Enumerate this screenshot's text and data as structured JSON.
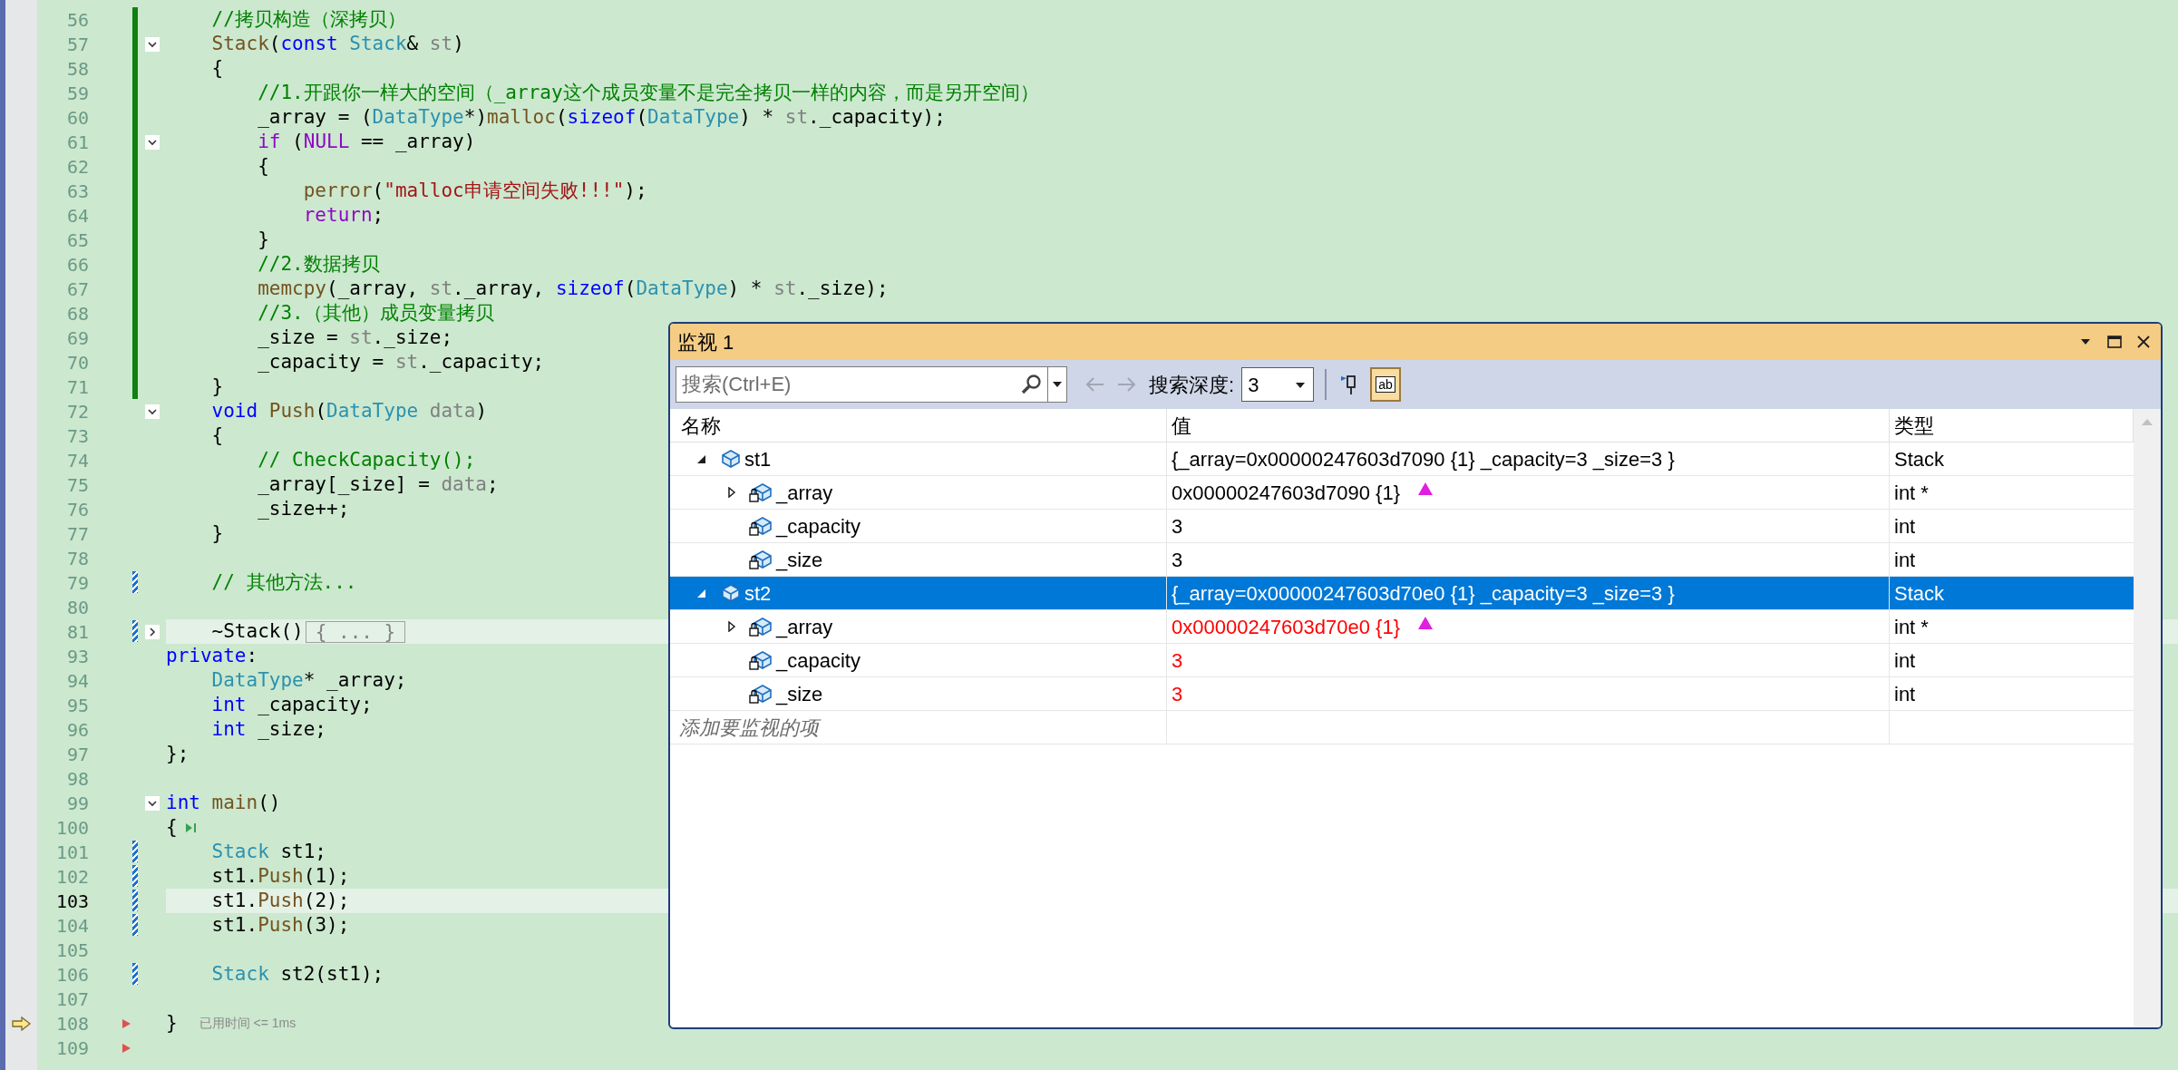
{
  "editor": {
    "lines": [
      {
        "number": "56",
        "saved_change": true,
        "tokens": [
          {
            "text": "    //拷贝构造（深拷贝）",
            "kind": "comment"
          }
        ]
      },
      {
        "number": "57",
        "saved_change": true,
        "foldable": true,
        "collapsed": false,
        "tokens": [
          {
            "text": "    Stack",
            "kind": "function"
          },
          {
            "text": "(",
            "kind": "plain"
          },
          {
            "text": "const",
            "kind": "keyword"
          },
          {
            "text": " Stack",
            "kind": "type"
          },
          {
            "text": "& ",
            "kind": "plain"
          },
          {
            "text": "st",
            "kind": "param"
          },
          {
            "text": ")",
            "kind": "plain"
          }
        ]
      },
      {
        "number": "58",
        "saved_change": true,
        "tokens": [
          {
            "text": "    {",
            "kind": "plain"
          }
        ]
      },
      {
        "number": "59",
        "saved_change": true,
        "tokens": [
          {
            "text": "        //1.开跟你一样大的空间（_array这个成员变量不是完全拷贝一样的内容，而是另开空间）",
            "kind": "comment"
          }
        ]
      },
      {
        "number": "60",
        "saved_change": true,
        "tokens": [
          {
            "text": "        _array = (",
            "kind": "plain"
          },
          {
            "text": "DataType",
            "kind": "type"
          },
          {
            "text": "*)",
            "kind": "plain"
          },
          {
            "text": "malloc",
            "kind": "function"
          },
          {
            "text": "(",
            "kind": "plain"
          },
          {
            "text": "sizeof",
            "kind": "keyword"
          },
          {
            "text": "(",
            "kind": "plain"
          },
          {
            "text": "DataType",
            "kind": "type"
          },
          {
            "text": ") * ",
            "kind": "plain"
          },
          {
            "text": "st",
            "kind": "param"
          },
          {
            "text": "._capacity);",
            "kind": "plain"
          }
        ]
      },
      {
        "number": "61",
        "saved_change": true,
        "foldable": true,
        "collapsed": false,
        "tokens": [
          {
            "text": "        if",
            "kind": "control"
          },
          {
            "text": " (",
            "kind": "plain"
          },
          {
            "text": "NULL",
            "kind": "control"
          },
          {
            "text": " == _array)",
            "kind": "plain"
          }
        ]
      },
      {
        "number": "62",
        "saved_change": true,
        "tokens": [
          {
            "text": "        {",
            "kind": "plain"
          }
        ]
      },
      {
        "number": "63",
        "saved_change": true,
        "tokens": [
          {
            "text": "            perror",
            "kind": "function"
          },
          {
            "text": "(",
            "kind": "plain"
          },
          {
            "text": "\"malloc申请空间失败!!!\"",
            "kind": "string"
          },
          {
            "text": ");",
            "kind": "plain"
          }
        ]
      },
      {
        "number": "64",
        "saved_change": true,
        "tokens": [
          {
            "text": "            return",
            "kind": "control"
          },
          {
            "text": ";",
            "kind": "plain"
          }
        ]
      },
      {
        "number": "65",
        "saved_change": true,
        "tokens": [
          {
            "text": "        }",
            "kind": "plain"
          }
        ]
      },
      {
        "number": "66",
        "saved_change": true,
        "tokens": [
          {
            "text": "        //2.数据拷贝",
            "kind": "comment"
          }
        ]
      },
      {
        "number": "67",
        "saved_change": true,
        "tokens": [
          {
            "text": "        memcpy",
            "kind": "function"
          },
          {
            "text": "(_array, ",
            "kind": "plain"
          },
          {
            "text": "st",
            "kind": "param"
          },
          {
            "text": "._array, ",
            "kind": "plain"
          },
          {
            "text": "sizeof",
            "kind": "keyword"
          },
          {
            "text": "(",
            "kind": "plain"
          },
          {
            "text": "DataType",
            "kind": "type"
          },
          {
            "text": ") * ",
            "kind": "plain"
          },
          {
            "text": "st",
            "kind": "param"
          },
          {
            "text": "._size);",
            "kind": "plain"
          }
        ]
      },
      {
        "number": "68",
        "saved_change": true,
        "tokens": [
          {
            "text": "        //3.（其他）成员变量拷贝",
            "kind": "comment"
          }
        ]
      },
      {
        "number": "69",
        "saved_change": true,
        "tokens": [
          {
            "text": "        _size = ",
            "kind": "plain"
          },
          {
            "text": "st",
            "kind": "param"
          },
          {
            "text": "._size;",
            "kind": "plain"
          }
        ]
      },
      {
        "number": "70",
        "saved_change": true,
        "tokens": [
          {
            "text": "        _capacity = ",
            "kind": "plain"
          },
          {
            "text": "st",
            "kind": "param"
          },
          {
            "text": "._capacity;",
            "kind": "plain"
          }
        ]
      },
      {
        "number": "71",
        "saved_change": true,
        "tokens": [
          {
            "text": "    }",
            "kind": "plain"
          }
        ]
      },
      {
        "number": "72",
        "foldable": true,
        "collapsed": false,
        "tokens": [
          {
            "text": "    void",
            "kind": "keyword"
          },
          {
            "text": " Push",
            "kind": "function"
          },
          {
            "text": "(",
            "kind": "plain"
          },
          {
            "text": "DataType",
            "kind": "type"
          },
          {
            "text": " data",
            "kind": "param"
          },
          {
            "text": ")",
            "kind": "plain"
          }
        ]
      },
      {
        "number": "73",
        "tokens": [
          {
            "text": "    {",
            "kind": "plain"
          }
        ]
      },
      {
        "number": "74",
        "tokens": [
          {
            "text": "        // CheckCapacity();",
            "kind": "comment"
          }
        ]
      },
      {
        "number": "75",
        "tokens": [
          {
            "text": "        _array[_size] = ",
            "kind": "plain"
          },
          {
            "text": "data",
            "kind": "param"
          },
          {
            "text": ";",
            "kind": "plain"
          }
        ]
      },
      {
        "number": "76",
        "tokens": [
          {
            "text": "        _size++;",
            "kind": "plain"
          }
        ]
      },
      {
        "number": "77",
        "tokens": [
          {
            "text": "    }",
            "kind": "plain"
          }
        ]
      },
      {
        "number": "78"
      },
      {
        "number": "79",
        "unsaved_change": true,
        "tokens": [
          {
            "text": "    // 其他方法...",
            "kind": "comment"
          }
        ]
      },
      {
        "number": "80"
      },
      {
        "number": "81",
        "unsaved_change": true,
        "foldable": true,
        "collapsed": true,
        "highlight": true,
        "tokens": [
          {
            "text": "    ~Stack()",
            "kind": "plain"
          },
          {
            "text": "{ ... }",
            "kind": "collapsed"
          }
        ]
      },
      {
        "number": "93",
        "tokens": [
          {
            "text": "private",
            "kind": "keyword"
          },
          {
            "text": ":",
            "kind": "plain"
          }
        ]
      },
      {
        "number": "94",
        "tokens": [
          {
            "text": "    DataType",
            "kind": "type"
          },
          {
            "text": "* _array;",
            "kind": "plain"
          }
        ]
      },
      {
        "number": "95",
        "tokens": [
          {
            "text": "    int",
            "kind": "keyword"
          },
          {
            "text": " _capacity;",
            "kind": "plain"
          }
        ]
      },
      {
        "number": "96",
        "tokens": [
          {
            "text": "    int",
            "kind": "keyword"
          },
          {
            "text": " _size;",
            "kind": "plain"
          }
        ]
      },
      {
        "number": "97",
        "tokens": [
          {
            "text": "};",
            "kind": "plain"
          }
        ]
      },
      {
        "number": "98"
      },
      {
        "number": "99",
        "foldable": true,
        "collapsed": false,
        "tokens": [
          {
            "text": "int",
            "kind": "keyword"
          },
          {
            "text": " main",
            "kind": "function"
          },
          {
            "text": "()",
            "kind": "plain"
          }
        ]
      },
      {
        "number": "100",
        "run_to_click": true,
        "tokens": [
          {
            "text": "{",
            "kind": "plain"
          }
        ]
      },
      {
        "number": "101",
        "unsaved_change": true,
        "tokens": [
          {
            "text": "    Stack",
            "kind": "type"
          },
          {
            "text": " st1;",
            "kind": "plain"
          }
        ]
      },
      {
        "number": "102",
        "unsaved_change": true,
        "tokens": [
          {
            "text": "    st1.",
            "kind": "plain"
          },
          {
            "text": "Push",
            "kind": "function"
          },
          {
            "text": "(1);",
            "kind": "plain"
          }
        ]
      },
      {
        "number": "103",
        "unsaved_change": true,
        "highlight": true,
        "current": true,
        "tokens": [
          {
            "text": "    st1.",
            "kind": "plain"
          },
          {
            "text": "Push",
            "kind": "function"
          },
          {
            "text": "(2);",
            "kind": "plain"
          }
        ]
      },
      {
        "number": "104",
        "unsaved_change": true,
        "tokens": [
          {
            "text": "    st1.",
            "kind": "plain"
          },
          {
            "text": "Push",
            "kind": "function"
          },
          {
            "text": "(3);",
            "kind": "plain"
          }
        ]
      },
      {
        "number": "105"
      },
      {
        "number": "106",
        "unsaved_change": true,
        "tokens": [
          {
            "text": "    Stack",
            "kind": "type"
          },
          {
            "text": " st2(st1);",
            "kind": "plain"
          }
        ]
      },
      {
        "number": "107"
      },
      {
        "number": "108",
        "execution": true,
        "marker": true,
        "hint": "已用时间 <= 1ms",
        "tokens": [
          {
            "text": "}",
            "kind": "plain"
          }
        ]
      },
      {
        "number": "109",
        "marker": true
      }
    ]
  },
  "watch": {
    "title": "监视 1",
    "search": {
      "placeholder": "搜索(Ctrl+E)"
    },
    "depth_label": "搜索深度:",
    "depth": "3",
    "hex_toggle": {
      "label": "ab",
      "on": true
    },
    "columns": [
      "名称",
      "值",
      "类型"
    ],
    "rows": [
      {
        "name": "st1",
        "kind": "object",
        "value": "{_array=0x00000247603d7090 {1} _capacity=3 _size=3 }",
        "type": "Stack",
        "expanded": true,
        "selected": false,
        "changed": false,
        "children": [
          {
            "name": "_array",
            "kind": "member",
            "value": "0x00000247603d7090 {1}",
            "type": "int *",
            "expanded": false,
            "selected": false,
            "changed": false,
            "pointer_marker": true
          },
          {
            "name": "_capacity",
            "kind": "member",
            "value": "3",
            "type": "int",
            "selected": false,
            "changed": false
          },
          {
            "name": "_size",
            "kind": "member",
            "value": "3",
            "type": "int",
            "selected": false,
            "changed": false
          }
        ]
      },
      {
        "name": "st2",
        "kind": "object",
        "value": "{_array=0x00000247603d70e0 {1} _capacity=3 _size=3 }",
        "type": "Stack",
        "expanded": true,
        "selected": true,
        "changed": false,
        "children": [
          {
            "name": "_array",
            "kind": "member",
            "value": "0x00000247603d70e0 {1}",
            "type": "int *",
            "expanded": false,
            "selected": false,
            "changed": true,
            "pointer_marker": true
          },
          {
            "name": "_capacity",
            "kind": "member",
            "value": "3",
            "type": "int",
            "selected": false,
            "changed": true
          },
          {
            "name": "_size",
            "kind": "member",
            "value": "3",
            "type": "int",
            "selected": false,
            "changed": true
          }
        ]
      }
    ],
    "add_placeholder": "添加要监视的项"
  }
}
